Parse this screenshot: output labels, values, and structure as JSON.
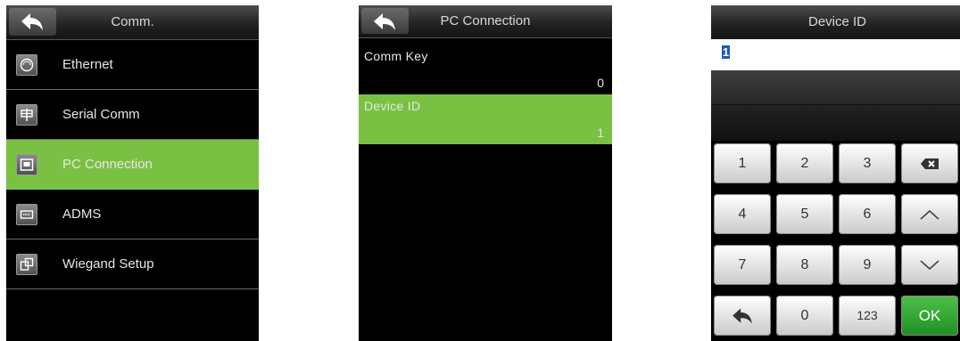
{
  "screen1": {
    "title": "Comm.",
    "items": [
      {
        "label": "Ethernet",
        "icon": "ethernet-icon"
      },
      {
        "label": "Serial Comm",
        "icon": "serial-comm-icon"
      },
      {
        "label": "PC Connection",
        "icon": "pc-connection-icon",
        "selected": true
      },
      {
        "label": "ADMS",
        "icon": "adms-icon"
      },
      {
        "label": "Wiegand Setup",
        "icon": "wiegand-icon"
      }
    ]
  },
  "screen2": {
    "title": "PC Connection",
    "items": [
      {
        "label": "Comm Key",
        "value": "0"
      },
      {
        "label": "Device ID",
        "value": "1",
        "selected": true
      }
    ]
  },
  "screen3": {
    "title": "Device ID",
    "input_value": "1",
    "keys": [
      "1",
      "2",
      "3",
      "backspace",
      "4",
      "5",
      "6",
      "up",
      "7",
      "8",
      "9",
      "down",
      "back",
      "0",
      "123",
      "OK"
    ],
    "key_labels": {
      "k1": "1",
      "k2": "2",
      "k3": "3",
      "k4": "4",
      "k5": "5",
      "k6": "6",
      "k7": "7",
      "k8": "8",
      "k9": "9",
      "k0": "0",
      "k123": "123",
      "ok": "OK"
    }
  },
  "colors": {
    "selected": "#7ac143",
    "background": "#000000",
    "ok_key": "#2fa830",
    "caret": "#1f5bb5"
  }
}
